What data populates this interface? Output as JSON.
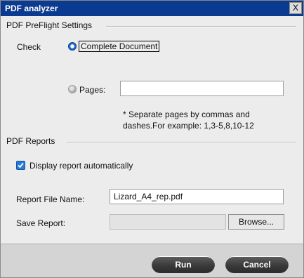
{
  "window": {
    "title": "PDF analyzer",
    "close_glyph": "X"
  },
  "preflight": {
    "section_label": "PDF PreFlight Settings",
    "check_label": "Check",
    "complete_document_label": "Complete Document",
    "pages_label": "Pages:",
    "pages_value": "",
    "selected_option": "complete-document",
    "note_line1": "* Separate pages by commas and",
    "note_line2": "dashes.For example: 1,3-5,8,10-12"
  },
  "reports": {
    "section_label": "PDF Reports",
    "display_auto_label": "Display report automatically",
    "display_auto_checked": true,
    "file_name_label": "Report File Name:",
    "file_name_value": "Lizard_A4_rep.pdf",
    "save_label": "Save Report:",
    "save_value": "",
    "browse_label": "Browse..."
  },
  "footer": {
    "run_label": "Run",
    "cancel_label": "Cancel"
  },
  "colors": {
    "title_bar": "#0b3a91",
    "accent": "#1f6dd3",
    "button": "#3a3a3a"
  }
}
